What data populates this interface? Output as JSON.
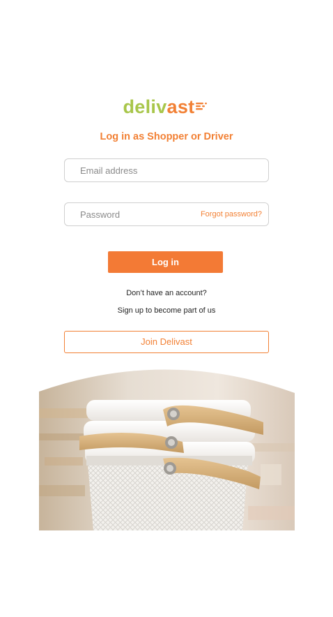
{
  "brand": {
    "logo_part1": "deliv",
    "logo_part2": "ast",
    "primary_color": "#f28034",
    "secondary_color": "#a8c64a"
  },
  "login": {
    "title": "Log in as Shopper or Driver",
    "email_placeholder": "Email address",
    "password_placeholder": "Password",
    "forgot_password": "Forgot password?",
    "login_button": "Log in",
    "no_account_text": "Don’t have an account?",
    "signup_text": "Sign up to become part of us",
    "join_button": "Join Delivast"
  },
  "hero_image": {
    "icon": "stacked-baskets-photo"
  }
}
